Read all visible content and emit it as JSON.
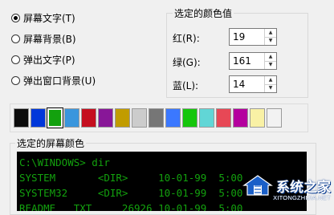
{
  "radio_options": [
    {
      "label": "屏幕文字(T)",
      "checked": true
    },
    {
      "label": "屏幕背景(B)",
      "checked": false
    },
    {
      "label": "弹出文字(P)",
      "checked": false
    },
    {
      "label": "弹出窗口背景(U)",
      "checked": false
    }
  ],
  "color_values": {
    "legend": "选定的颜色值",
    "red": {
      "label": "红(R):",
      "value": "19"
    },
    "green": {
      "label": "绿(G):",
      "value": "161"
    },
    "blue": {
      "label": "蓝(L):",
      "value": "14"
    }
  },
  "palette": {
    "colors": [
      "#0c0c0c",
      "#0037da",
      "#13a10e",
      "#3a96dd",
      "#c50f1f",
      "#881798",
      "#c19c00",
      "#cccccc",
      "#767676",
      "#3b78ff",
      "#16c60c",
      "#61d6d6",
      "#e74856",
      "#b4009e",
      "#f9f1a5",
      "#f2f2f2"
    ],
    "selected_index": 2
  },
  "preview": {
    "legend": "选定的屏幕颜色",
    "text_color": "#13a10e",
    "background": "#000000",
    "lines": [
      "C:\\WINDOWS> dir",
      "SYSTEM       <DIR>     10-01-99  5:00",
      "SYSTEM32     <DIR>     10-01-99  5:00",
      "README   TXT     26926 10-01-99  5:00"
    ]
  },
  "watermark": {
    "main": "系统之家",
    "sub": "XITONGZHIJIA.NET"
  }
}
